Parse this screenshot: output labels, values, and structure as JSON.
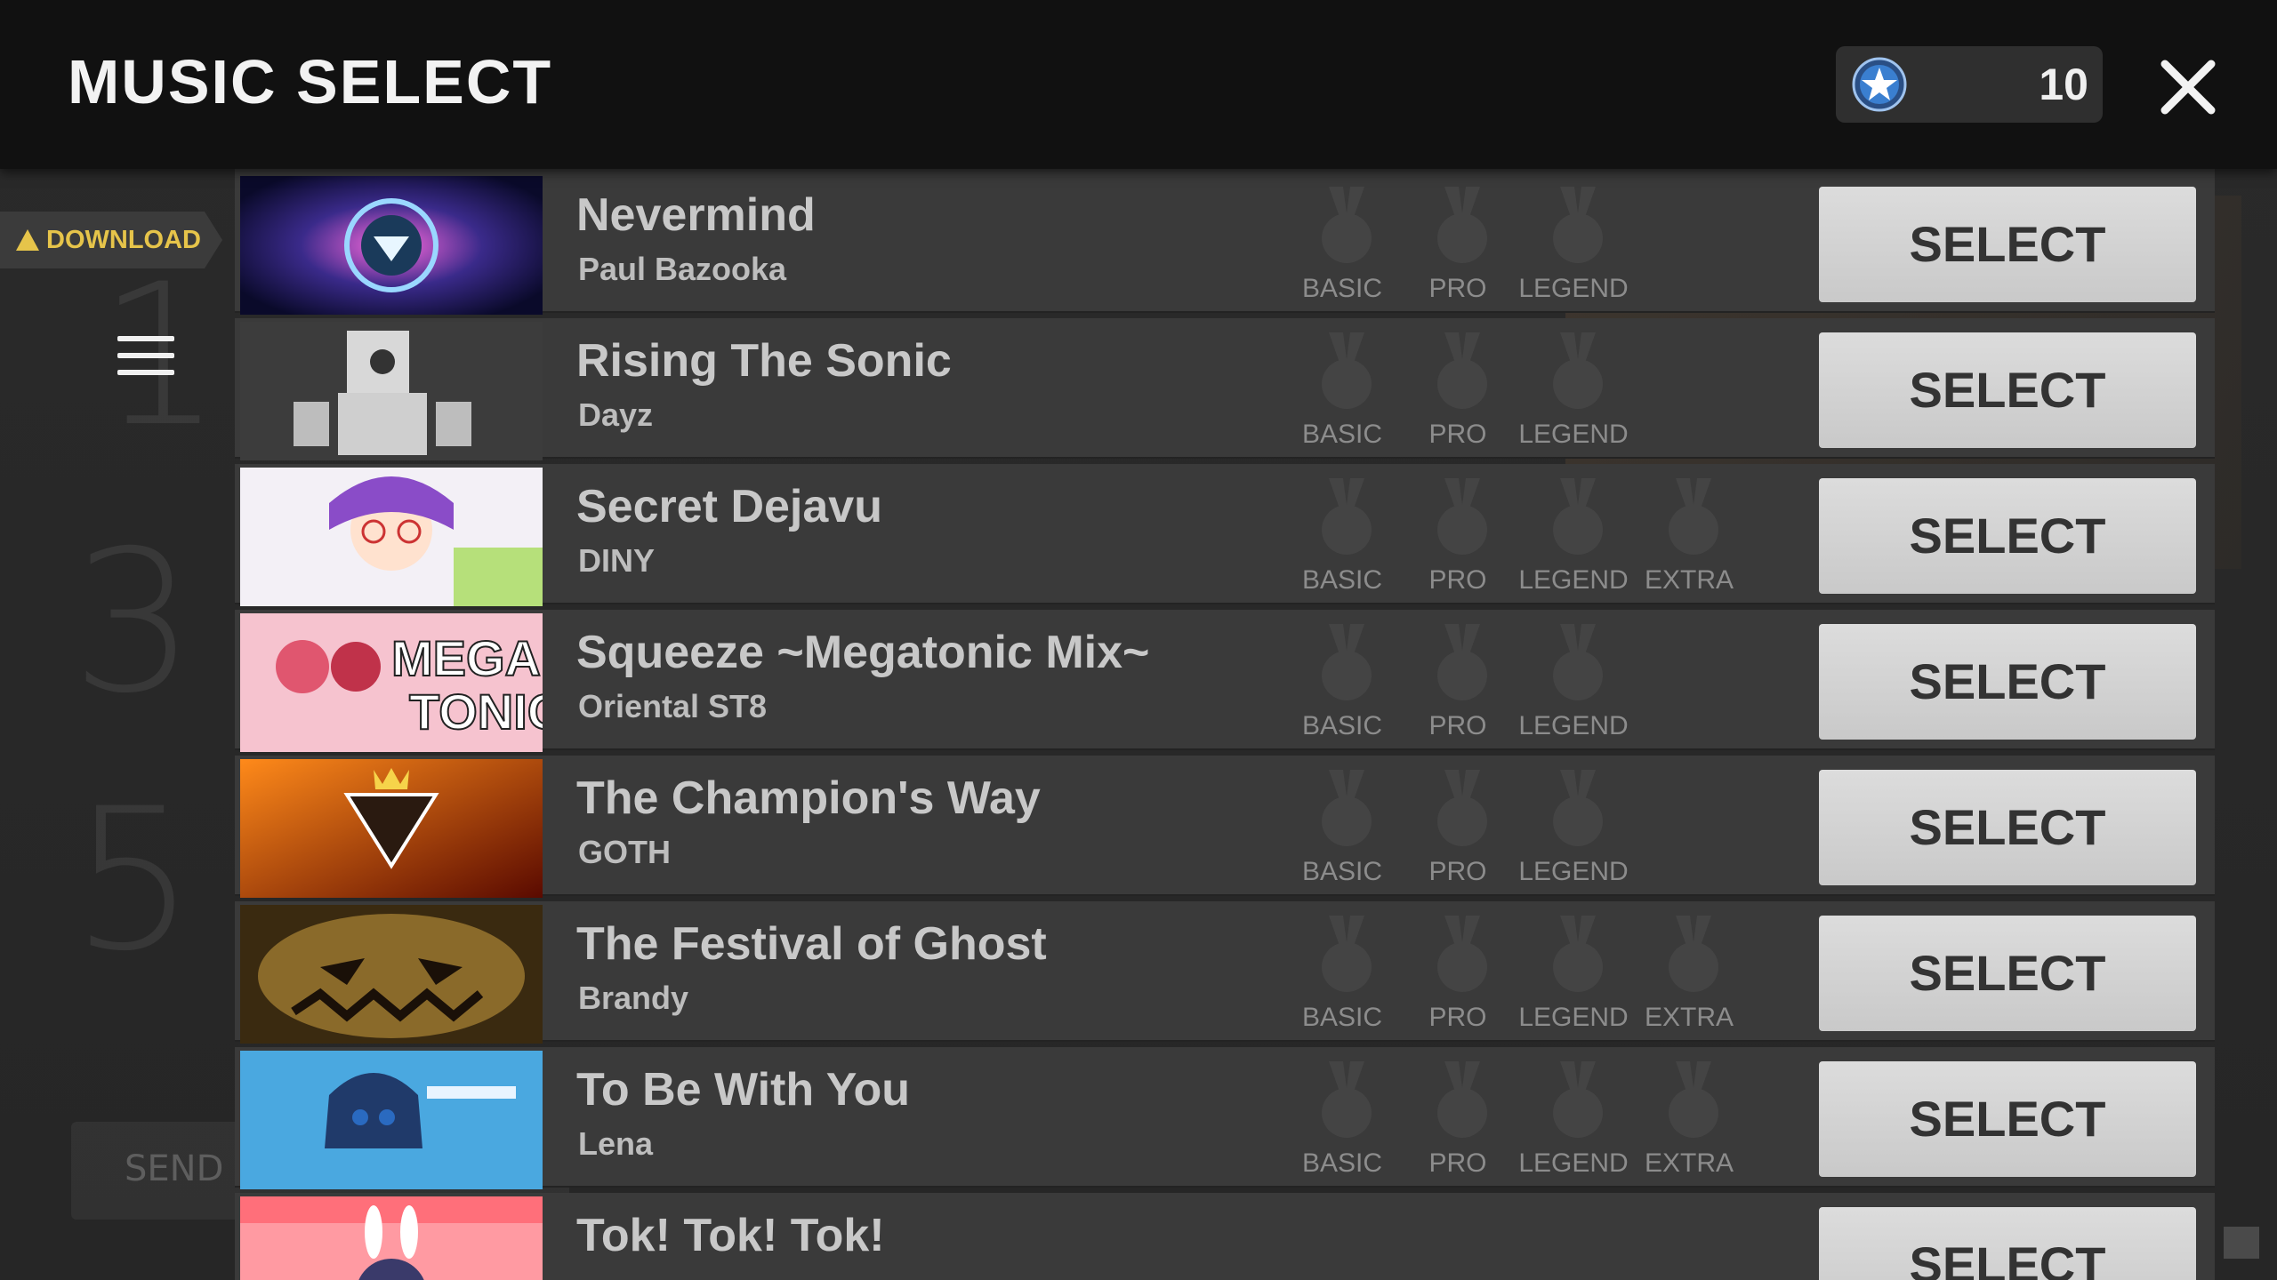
{
  "header": {
    "title": "MUSIC SELECT",
    "currency_value": "10"
  },
  "sidebar": {
    "download_label": "DOWNLOAD"
  },
  "background": {
    "send_label": "SEND",
    "digits": [
      "1",
      "3",
      "5"
    ]
  },
  "colors": {
    "header_bg": "#111111",
    "row_bg": "#3a3a3a",
    "select_button": "#d4d4d4",
    "download_accent": "#e6c44a",
    "currency_star": "#3a7fd0"
  },
  "songs": [
    {
      "title": "Nevermind",
      "artist": "Paul Bazooka",
      "difficulties": [
        "BASIC",
        "PRO",
        "LEGEND"
      ],
      "button": "SELECT"
    },
    {
      "title": "Rising The Sonic",
      "artist": "Dayz",
      "difficulties": [
        "BASIC",
        "PRO",
        "LEGEND"
      ],
      "button": "SELECT"
    },
    {
      "title": "Secret Dejavu",
      "artist": "DINY",
      "difficulties": [
        "BASIC",
        "PRO",
        "LEGEND",
        "EXTRA"
      ],
      "button": "SELECT"
    },
    {
      "title": "Squeeze ~Megatonic Mix~",
      "artist": "Oriental ST8",
      "difficulties": [
        "BASIC",
        "PRO",
        "LEGEND"
      ],
      "button": "SELECT"
    },
    {
      "title": "The Champion's Way",
      "artist": "GOTH",
      "difficulties": [
        "BASIC",
        "PRO",
        "LEGEND"
      ],
      "button": "SELECT"
    },
    {
      "title": "The Festival of Ghost",
      "artist": "Brandy",
      "difficulties": [
        "BASIC",
        "PRO",
        "LEGEND",
        "EXTRA"
      ],
      "button": "SELECT"
    },
    {
      "title": "To Be With You",
      "artist": "Lena",
      "difficulties": [
        "BASIC",
        "PRO",
        "LEGEND",
        "EXTRA"
      ],
      "button": "SELECT"
    },
    {
      "title": "Tok! Tok! Tok!",
      "artist": "",
      "difficulties": [],
      "button": "SELECT"
    }
  ],
  "icons": {
    "close": "close-icon",
    "currency": "star-coin-icon",
    "menu": "hamburger-menu-icon",
    "download": "warning-triangle-icon",
    "medal": "medal-icon"
  }
}
